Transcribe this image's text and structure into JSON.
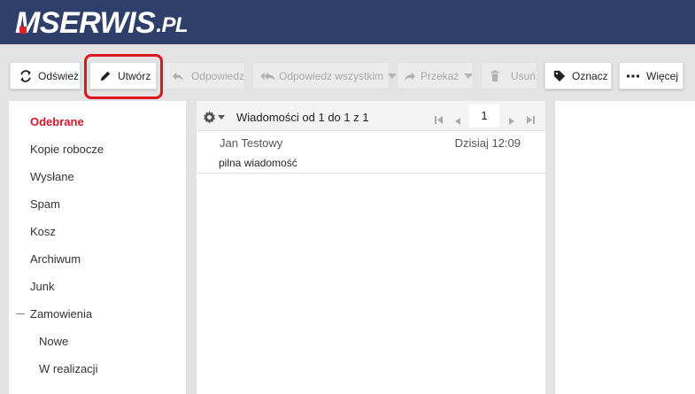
{
  "logo": {
    "m": "M",
    "name": "SERWIS",
    "tld": ".PL"
  },
  "toolbar": {
    "refresh": "Odśwież",
    "compose": "Utwórz",
    "reply": "Odpowiedz",
    "reply_all": "Odpowiedz wszystkim",
    "forward": "Przekaż",
    "delete": "Usuń",
    "mark": "Oznacz",
    "more": "Więcej"
  },
  "sidebar": {
    "items": [
      {
        "label": "Odebrane",
        "active": true
      },
      {
        "label": "Kopie robocze"
      },
      {
        "label": "Wysłane"
      },
      {
        "label": "Spam"
      },
      {
        "label": "Kosz"
      },
      {
        "label": "Archiwum"
      },
      {
        "label": "Junk"
      },
      {
        "label": "Zamowienia",
        "expanded": true
      },
      {
        "label": "Nowe",
        "child": true
      },
      {
        "label": "W realizacji",
        "child": true
      }
    ]
  },
  "messagelist": {
    "range_text": "Wiadomości od 1 do 1 z 1",
    "page": "1",
    "messages": [
      {
        "from": "Jan Testowy",
        "date": "Dzisiaj 12:09",
        "subject": "pilna wiadomość"
      }
    ]
  },
  "colors": {
    "header": "#2f3f6b",
    "accent": "#d7152b",
    "highlight": "#e0141e"
  }
}
